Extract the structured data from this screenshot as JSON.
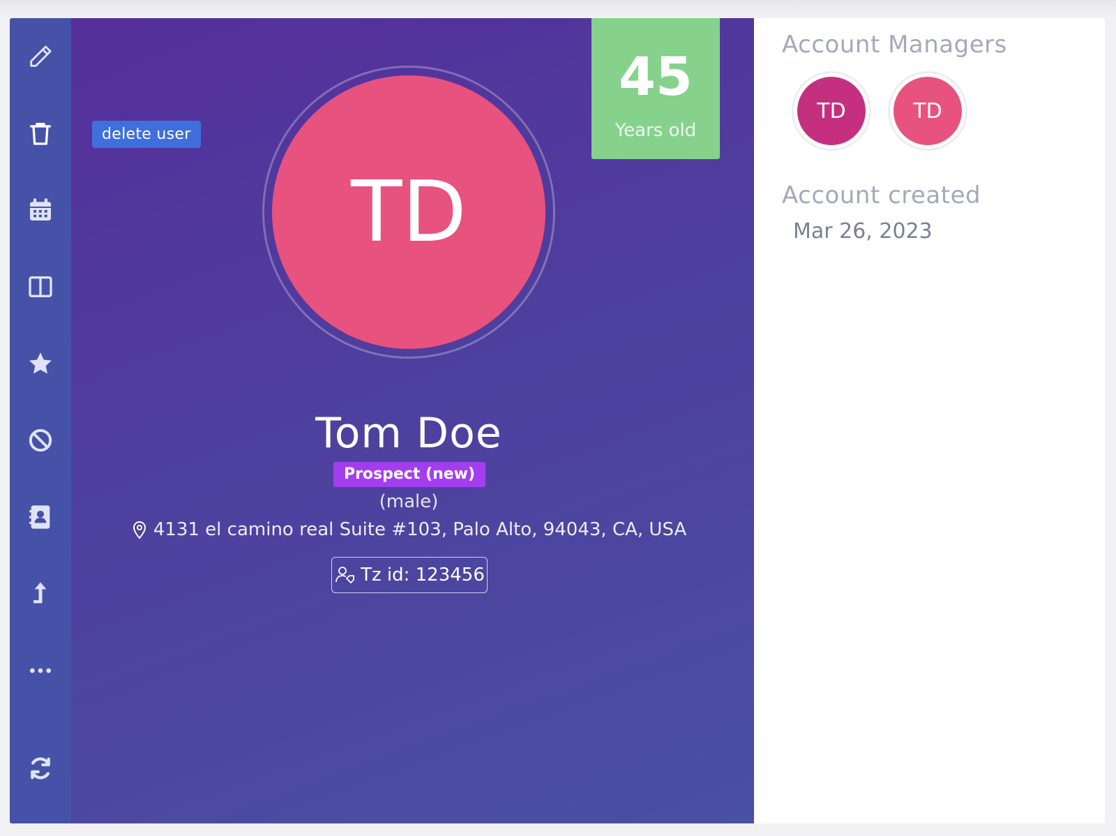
{
  "sidebar": {
    "items": [
      {
        "icon": "pencil-icon",
        "action": "edit"
      },
      {
        "icon": "trash-icon",
        "action": "delete"
      },
      {
        "icon": "calendar-icon",
        "action": "calendar"
      },
      {
        "icon": "columns-icon",
        "action": "layout"
      },
      {
        "icon": "star-icon",
        "action": "favorite"
      },
      {
        "icon": "ban-icon",
        "action": "block"
      },
      {
        "icon": "contact-book-icon",
        "action": "contacts"
      },
      {
        "icon": "arrow-up-icon",
        "action": "move"
      },
      {
        "icon": "ellipsis-icon",
        "action": "more"
      },
      {
        "icon": "refresh-icon",
        "action": "refresh"
      }
    ]
  },
  "tooltip": {
    "text": "delete user"
  },
  "profile": {
    "initials": "TD",
    "age": "45",
    "age_label": "Years old",
    "name": "Tom Doe",
    "status": "Prospect (new)",
    "gender": "(male)",
    "address": "4131 el camino real Suite #103, Palo Alto, 94043, CA, USA",
    "tz_id": "Tz id: 123456"
  },
  "account_managers": {
    "title": "Account Managers",
    "managers": [
      {
        "initials": "TD",
        "color": "#c4307f"
      },
      {
        "initials": "TD",
        "color": "#e8527f"
      }
    ]
  },
  "account_created": {
    "title": "Account created",
    "date": "Mar 26, 2023"
  },
  "colors": {
    "sidebar": "#4651a8",
    "avatar": "#e8527f",
    "age_box": "#86d28d",
    "status_badge": "#a33ef0",
    "tooltip": "#3f6fdc"
  }
}
